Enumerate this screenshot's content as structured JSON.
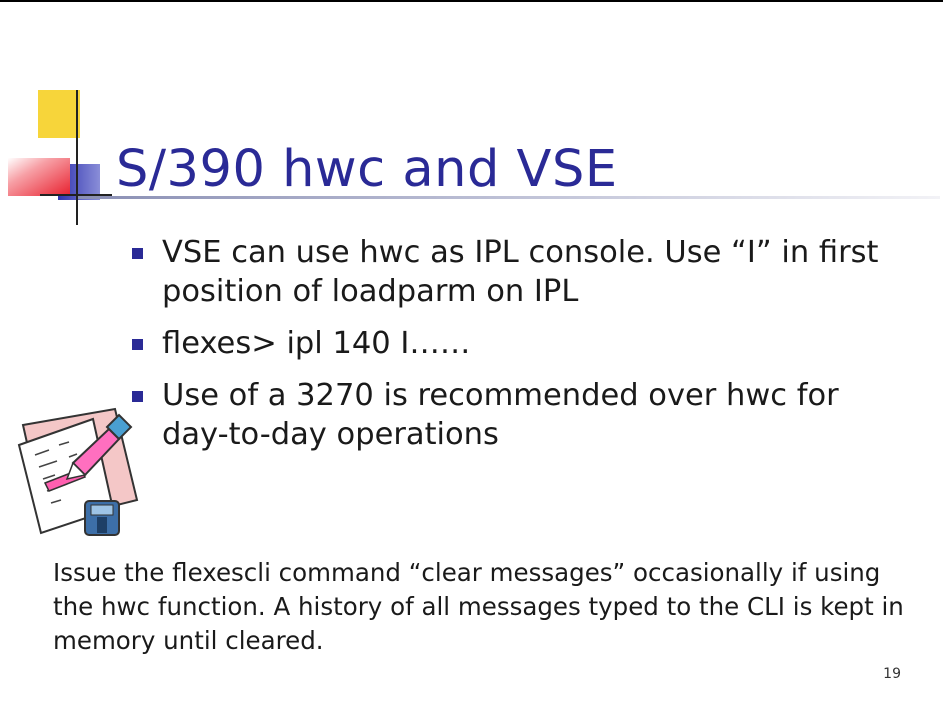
{
  "slide": {
    "title": "S/390 hwc and VSE",
    "bullets": [
      "VSE can use hwc as IPL console. Use “I” in first position of loadparm on IPL",
      "flexes> ipl 140 I……",
      "Use of a 3270 is recommended over hwc for day-to-day operations"
    ],
    "note": "Issue the flexescli command “clear messages” occasionally if using the hwc function. A history of all messages typed to the CLI is kept in memory until cleared.",
    "page_number": "19"
  },
  "icons": {
    "title_decoration": "overlapping-squares-crosshair-icon",
    "clipart": "paper-and-highlighter-clipart-icon"
  },
  "colors": {
    "title": "#2a2a96",
    "bullet_marker": "#2a2a96",
    "body_text": "#1a1a1a",
    "deco_yellow": "#f7d53a",
    "deco_blue": "#3034b0",
    "deco_red": "#e8202e"
  }
}
